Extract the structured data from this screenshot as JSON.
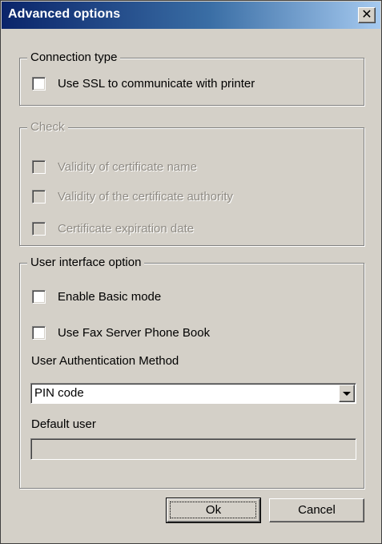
{
  "window": {
    "title": "Advanced options",
    "close_glyph": "✕"
  },
  "connection_type": {
    "label": "Connection type",
    "use_ssl": {
      "label": "Use SSL to communicate with printer",
      "checked": false
    }
  },
  "check": {
    "label": "Check",
    "items": [
      {
        "label": "Validity of certificate name",
        "checked": false,
        "enabled": false
      },
      {
        "label": "Validity of the certificate authority",
        "checked": false,
        "enabled": false
      },
      {
        "label": "Certificate expiration date",
        "checked": false,
        "enabled": false
      }
    ]
  },
  "user_interface": {
    "label": "User interface option",
    "basic_mode": {
      "label": "Enable Basic mode",
      "checked": false
    },
    "fax_phone_book": {
      "label": "Use Fax Server Phone Book",
      "checked": false
    },
    "auth_method": {
      "label": "User Authentication Method",
      "selected": "PIN code"
    },
    "default_user": {
      "label": "Default user",
      "value": ""
    }
  },
  "buttons": {
    "ok": "Ok",
    "cancel": "Cancel"
  },
  "icons": {
    "close": "close-icon",
    "dropdown": "chevron-down-icon"
  },
  "colors": {
    "title_gradient_start": "#0a246a",
    "title_gradient_end": "#a6caf0",
    "dialog_face": "#d4d0c8",
    "disabled_text": "#8f8b84"
  }
}
